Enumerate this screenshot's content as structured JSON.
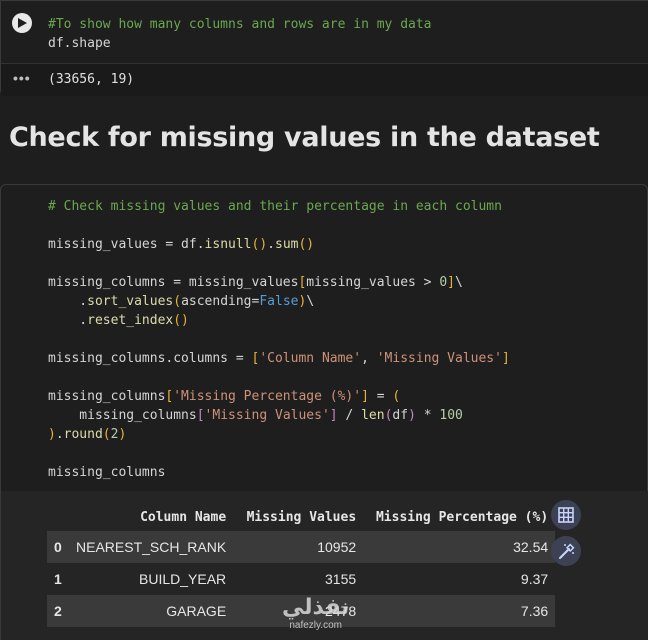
{
  "cell1": {
    "code_lines": [
      "#To show how many columns and rows are in my data",
      "df.shape"
    ],
    "output": "(33656, 19)",
    "output_menu_icon": "more-horiz-icon"
  },
  "heading": "Check for missing values in the dataset",
  "cell2": {
    "comment": "# Check missing values and their percentage in each column",
    "line_isnull": "missing_values = df.isnull().sum()",
    "line_missing_cols_1": "missing_columns = missing_values[missing_values > 0]\\",
    "line_missing_cols_2": "    .sort_values(ascending=False)\\",
    "line_missing_cols_3": "    .reset_index()",
    "line_columns": "missing_columns.columns = ['Column Name', 'Missing Values']",
    "line_pct_1": "missing_columns['Missing Percentage (%)'] = (",
    "line_pct_2": "    missing_columns['Missing Values'] / len(df) * 100",
    "line_pct_3": ").round(2)",
    "line_final": "missing_columns"
  },
  "table": {
    "headers": [
      "",
      "Column Name",
      "Missing Values",
      "Missing Percentage (%)"
    ],
    "rows": [
      {
        "index": "0",
        "column_name": "NEAREST_SCH_RANK",
        "missing_values": "10952",
        "missing_pct": "32.54"
      },
      {
        "index": "1",
        "column_name": "BUILD_YEAR",
        "missing_values": "3155",
        "missing_pct": "9.37"
      },
      {
        "index": "2",
        "column_name": "GARAGE",
        "missing_values": "2478",
        "missing_pct": "7.36"
      }
    ]
  },
  "icons": {
    "run": "play-icon",
    "table_view": "table-icon",
    "suggest_chart": "magic-wand-icon"
  },
  "watermark": {
    "arabic": "نفذلي",
    "latin": "nafezly.com"
  },
  "colors": {
    "comment": "#6aa84f",
    "string": "#ce9178",
    "keyword_false": "#569cd6",
    "number": "#b5cea8"
  }
}
